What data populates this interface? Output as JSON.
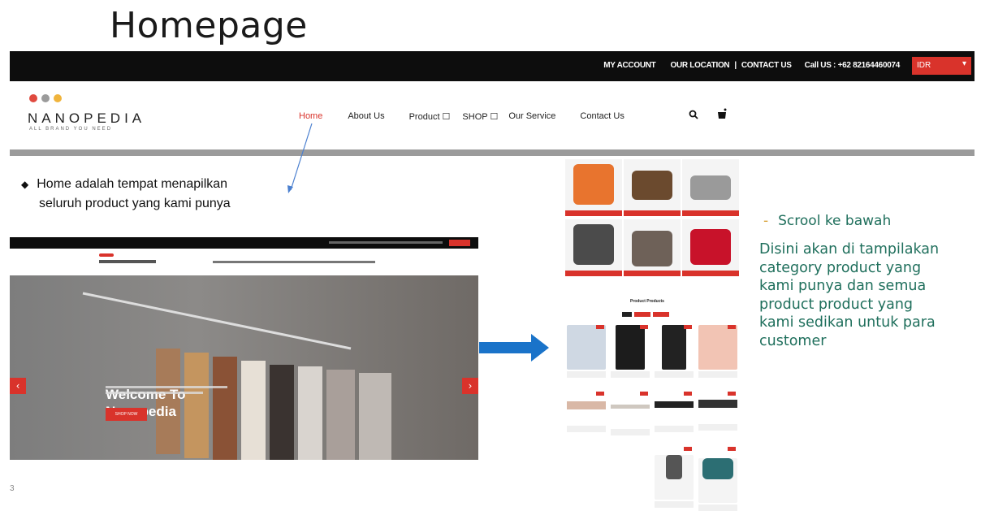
{
  "slide": {
    "title": "Homepage",
    "page_number": "3"
  },
  "topbar": {
    "links": [
      "MY ACCOUNT",
      "OUR LOCATION",
      "|",
      "CONTACT US",
      "Call US : +62 82164460074"
    ],
    "currency": "IDR",
    "currency_chevron": "▾"
  },
  "brand": {
    "dot_colors": [
      "#e04a3f",
      "#9b9b9b",
      "#f0b43c"
    ],
    "name": "NANOPEDIA",
    "tagline": "ALL BRAND YOU NEED"
  },
  "nav": {
    "items": [
      "Home",
      "About Us",
      "Product ☐",
      "SHOP ☐",
      "Our Service",
      "Contact Us"
    ],
    "active_index": 0,
    "active_color": "#d9332b",
    "icons": [
      "search-icon",
      "cart-icon"
    ],
    "search_glyph": "🔍",
    "cart_glyph": "🛒"
  },
  "annotation": {
    "bullet": "◆",
    "line1": "Home adalah tempat menapilkan",
    "line2": "seluruh product yang kami punya"
  },
  "hero": {
    "welcome_line1": "Welcome To",
    "welcome_line2": "Nanopedia",
    "button": "SHOP NOW",
    "prev": "‹",
    "next": "›"
  },
  "collage": {
    "product_section_title": "Product Products"
  },
  "right_text": {
    "dash": "-",
    "scroll": "Scrool ke bawah",
    "desc_lines": [
      "Disini akan di tampilakan",
      "category product yang",
      "kami punya dan semua",
      "product product yang",
      "kami sedikan untuk para",
      "customer"
    ]
  },
  "colors": {
    "accent": "#d9332b",
    "topbar_bg": "#0d0d0d",
    "text_teal": "#1f6f5c",
    "arrow_blue": "#1a73c9"
  }
}
